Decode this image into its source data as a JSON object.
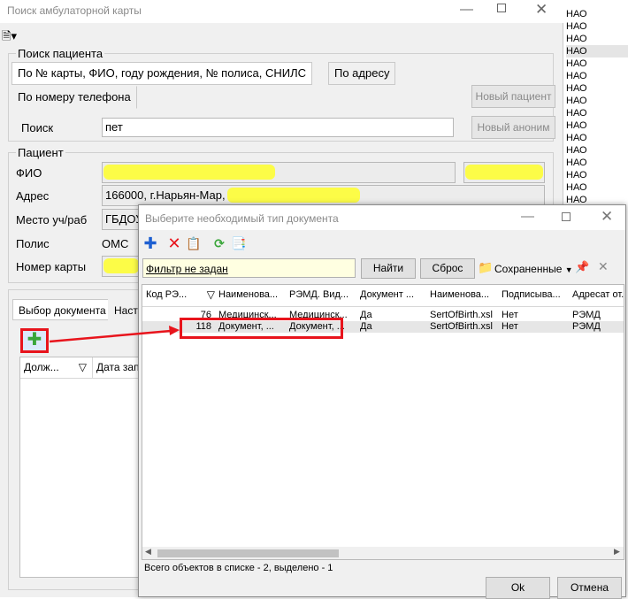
{
  "main_window": {
    "title": "Поиск амбулаторной карты",
    "search_group": {
      "title": "Поиск пациента",
      "tabs": [
        "По № карты, ФИО, году рождения, № полиса, СНИЛС",
        "По адресу",
        "По номеру телефона"
      ],
      "search_label": "Поиск",
      "search_value": "пет",
      "new_patient_button": "Новый пациент",
      "new_anon_button": "Новый аноним"
    },
    "patient_group": {
      "title": "Пациент",
      "fio_label": "ФИО",
      "address_label": "Адрес",
      "address_value": "166000, г.Нарьян-Мар,",
      "workplace_label": "Место уч/раб",
      "workplace_value": "ГБДОУ",
      "policy_label": "Полис",
      "policy_value": "ОМС",
      "card_label": "Номер карты"
    },
    "doc_tabs": [
      "Выбор документа",
      "Наст"
    ],
    "doc_columns": [
      "Долж...",
      "Дата зап"
    ]
  },
  "right_list": {
    "items": [
      "НАО",
      "НАО",
      "НАО",
      "НАО",
      "НАО",
      "НАО",
      "НАО",
      "НАО",
      "НАО",
      "НАО",
      "НАО",
      "НАО",
      "НАО",
      "НАО",
      "НАО",
      "НАО",
      "НАО",
      "НАО",
      "НАО"
    ]
  },
  "dialog": {
    "title": "Выберите необходимый тип документа",
    "filter_text": "Фильтр не задан",
    "find_button": "Найти",
    "reset_button": "Сброс",
    "saved_label": "Сохраненные",
    "columns": [
      "Код РЭ...",
      "Наименова...",
      "РЭМД. Вид...",
      "Документ ...",
      "Наименова...",
      "Подписыва...",
      "Адресат от..."
    ],
    "rows": [
      {
        "code": "76",
        "name": "Медицинск...",
        "remd": "Медицинск...",
        "doc": "Да",
        "file": "SertOfBirth.xsl",
        "sign": "Нет",
        "addr": "РЭМД"
      },
      {
        "code": "118",
        "name": "Документ, ...",
        "remd": "Документ, ...",
        "doc": "Да",
        "file": "SertOfBirth.xsl",
        "sign": "Нет",
        "addr": "РЭМД"
      }
    ],
    "status": "Всего объектов в списке - 2, выделено - 1",
    "ok_button": "Ok",
    "cancel_button": "Отмена"
  },
  "colors": {
    "annotation_red": "#e8141c",
    "highlight_yellow": "#ffff2a",
    "add_green": "#3aa63a"
  }
}
